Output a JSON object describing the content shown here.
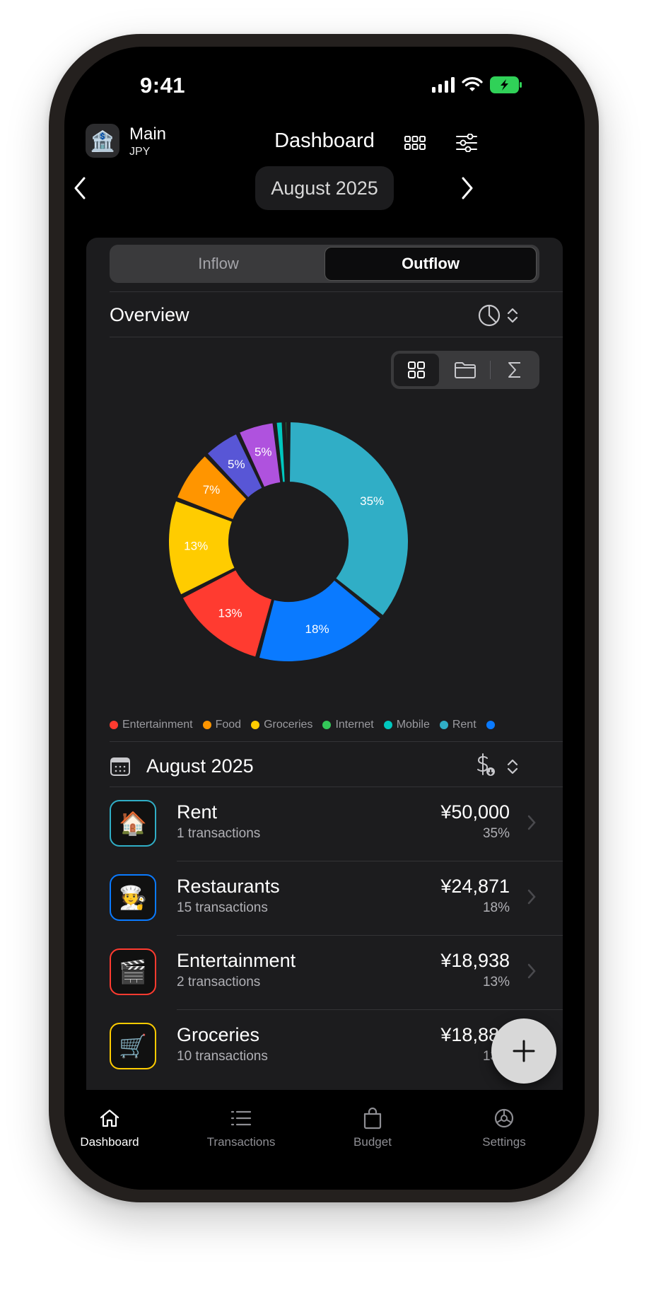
{
  "status": {
    "time": "9:41"
  },
  "header": {
    "account_name": "Main",
    "currency": "JPY",
    "title": "Dashboard",
    "month": "August 2025"
  },
  "flow_toggle": {
    "inflow": "Inflow",
    "outflow": "Outflow",
    "selected": "Outflow"
  },
  "overview": {
    "title": "Overview"
  },
  "chart_data": {
    "type": "pie",
    "style": "donut",
    "slices": [
      {
        "label": "35%",
        "value": 35,
        "color": "#30aec6"
      },
      {
        "label": "18%",
        "value": 18,
        "color": "#0a7aff"
      },
      {
        "label": "13%",
        "value": 13,
        "color": "#ff3b30"
      },
      {
        "label": "13%",
        "value": 13,
        "color": "#ffcc00"
      },
      {
        "label": "7%",
        "value": 7,
        "color": "#ff9500"
      },
      {
        "label": "5%",
        "value": 5,
        "color": "#5856d6"
      },
      {
        "label": "5%",
        "value": 5,
        "color": "#af52de"
      },
      {
        "label": "",
        "value": 1.2,
        "color": "#00c7be"
      },
      {
        "label": "",
        "value": 0.6,
        "color": "#34c759"
      }
    ],
    "legend": [
      {
        "name": "Entertainment",
        "color": "#ff3b30"
      },
      {
        "name": "Food",
        "color": "#ff9500"
      },
      {
        "name": "Groceries",
        "color": "#ffcc00"
      },
      {
        "name": "Internet",
        "color": "#34c759"
      },
      {
        "name": "Mobile",
        "color": "#00c7be"
      },
      {
        "name": "Rent",
        "color": "#30aec6"
      },
      {
        "name": "",
        "color": "#0a7aff"
      }
    ]
  },
  "period": {
    "title": "August 2025"
  },
  "categories": [
    {
      "icon": "🏠",
      "name": "Rent",
      "count": "1 transactions",
      "amount": "¥50,000",
      "percent": "35%",
      "color": "#30aec6"
    },
    {
      "icon": "🧑‍🍳",
      "name": "Restaurants",
      "count": "15 transactions",
      "amount": "¥24,871",
      "percent": "18%",
      "color": "#0a7aff"
    },
    {
      "icon": "🎬",
      "name": "Entertainment",
      "count": "2 transactions",
      "amount": "¥18,938",
      "percent": "13%",
      "color": "#ff3b30"
    },
    {
      "icon": "🛒",
      "name": "Groceries",
      "count": "10 transactions",
      "amount": "¥18,883",
      "percent": "13%",
      "color": "#ffcc00"
    }
  ],
  "tabs": [
    {
      "label": "Dashboard",
      "icon": "house-icon",
      "active": true
    },
    {
      "label": "Transactions",
      "icon": "list-icon",
      "active": false
    },
    {
      "label": "Budget",
      "icon": "bag-icon",
      "active": false
    },
    {
      "label": "Settings",
      "icon": "gear-icon",
      "active": false
    }
  ]
}
